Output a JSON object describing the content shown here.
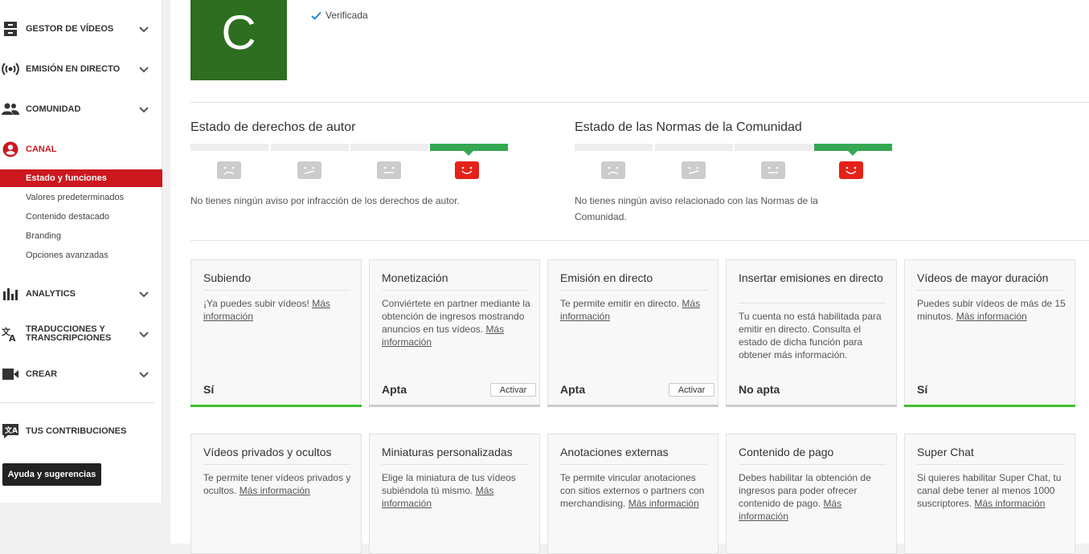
{
  "sidebar": {
    "items": [
      {
        "label": "GESTOR DE VÍDEOS",
        "icon": "video-manager-icon"
      },
      {
        "label": "EMISIÓN EN DIRECTO",
        "icon": "live-broadcast-icon"
      },
      {
        "label": "COMUNIDAD",
        "icon": "community-icon"
      },
      {
        "label": "CANAL",
        "icon": "channel-icon",
        "color": "#cc181e"
      },
      {
        "label": "ANALYTICS",
        "icon": "analytics-icon"
      },
      {
        "label": "TRADUCCIONES Y TRANSCRIPCIONES",
        "icon": "translate-icon"
      },
      {
        "label": "CREAR",
        "icon": "create-icon"
      },
      {
        "label": "TUS CONTRIBUCIONES",
        "icon": "contributions-icon"
      }
    ],
    "sub_items": [
      {
        "label": "Estado y funciones",
        "active": true
      },
      {
        "label": "Valores predeterminados"
      },
      {
        "label": "Contenido destacado"
      },
      {
        "label": "Branding"
      },
      {
        "label": "Opciones avanzadas"
      }
    ],
    "help_button": "Ayuda y sugerencias"
  },
  "channel": {
    "avatar_letter": "C",
    "avatar_color": "#2d6e20",
    "verified_label": "Verificada"
  },
  "copyright": {
    "title": "Estado de derechos de autor",
    "message": "No tienes ningún aviso por infracción de los derechos de autor."
  },
  "community": {
    "title": "Estado de las Normas de la Comunidad",
    "message_line1": "No tienes ningún aviso relacionado con las Normas de la",
    "message_line2": "Comunidad."
  },
  "link_text": "Más información",
  "cards_row1": [
    {
      "title": "Subiendo",
      "text": "¡Ya puedes subir vídeos!",
      "state": "Sí"
    },
    {
      "title": "Monetización",
      "text": "Conviértete en partner mediante la obtención de ingresos mostrando anuncios en tus vídeos.",
      "state": "Apta",
      "button": "Activar"
    },
    {
      "title": "Emisión en directo",
      "text": "Te permite emitir en directo.",
      "state": "Apta",
      "button": "Activar"
    },
    {
      "title": "Insertar emisiones en directo",
      "text": "Tu cuenta no está habilitada para emitir en directo. Consulta el estado de dicha función para obtener más información.",
      "state": "No apta"
    },
    {
      "title": "Vídeos de mayor duración",
      "text": "Puedes subir vídeos de más de 15 minutos.",
      "state": "Sí"
    }
  ],
  "cards_row2": [
    {
      "title": "Vídeos privados y ocultos",
      "text": "Te permite tener vídeos privados y ocultos."
    },
    {
      "title": "Miniaturas personalizadas",
      "text": "Elige la miniatura de tus vídeos subiéndola tú mismo."
    },
    {
      "title": "Anotaciones externas",
      "text": "Te permite vincular anotaciones con sitios externos o partners con merchandising."
    },
    {
      "title": "Contenido de pago",
      "text": "Debes habilitar la obtención de ingresos para poder ofrecer contenido de pago."
    },
    {
      "title": "Super Chat",
      "text": "Si quieres habilitar Super Chat, tu canal debe tener al menos 1000 suscriptores."
    }
  ]
}
